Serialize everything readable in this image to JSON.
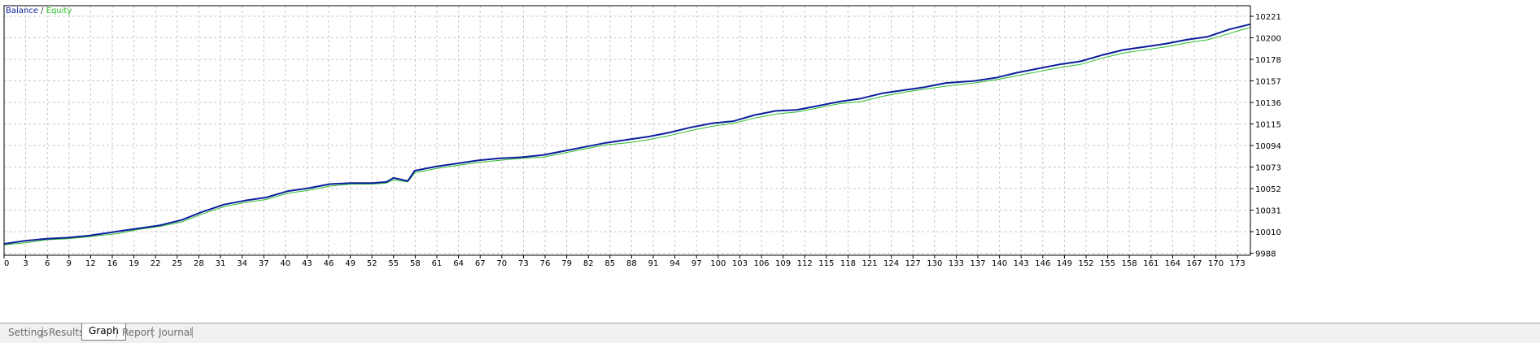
{
  "legend": {
    "balance": "Balance",
    "separator": "/",
    "equity": "Equity"
  },
  "tabs": [
    {
      "label": "Settings",
      "active": false
    },
    {
      "label": "Results",
      "active": false
    },
    {
      "label": "Graph",
      "active": true
    },
    {
      "label": "Report",
      "active": false
    },
    {
      "label": "Journal",
      "active": false
    }
  ],
  "colors": {
    "balance": "#0b1e9c",
    "equity": "#2dbd2d",
    "grid": "#c8c8c8",
    "frame": "#000000"
  },
  "chart_data": {
    "type": "line",
    "grid": true,
    "legend_position": "top-left",
    "x_tick_labels": [
      "0",
      "3",
      "6",
      "9",
      "12",
      "16",
      "19",
      "22",
      "25",
      "28",
      "31",
      "34",
      "37",
      "40",
      "43",
      "46",
      "49",
      "52",
      "55",
      "58",
      "61",
      "64",
      "67",
      "70",
      "73",
      "76",
      "79",
      "82",
      "85",
      "88",
      "91",
      "94",
      "97",
      "100",
      "103",
      "106",
      "109",
      "112",
      "115",
      "118",
      "121",
      "124",
      "127",
      "130",
      "133",
      "137",
      "140",
      "143",
      "146",
      "149",
      "152",
      "155",
      "158",
      "161",
      "164",
      "167",
      "170",
      "173"
    ],
    "y_tick_labels": [
      "10221",
      "10200",
      "10178",
      "10157",
      "10136",
      "10115",
      "10094",
      "10073",
      "10052",
      "10031",
      "10010",
      "9988"
    ],
    "xlim": [
      0,
      176
    ],
    "ylim": [
      9988,
      10230
    ],
    "series": [
      {
        "name": "Balance",
        "x": [
          0,
          3,
          6,
          9,
          12,
          16,
          19,
          22,
          25,
          28,
          31,
          34,
          37,
          40,
          43,
          46,
          49,
          52,
          54,
          55,
          57,
          58,
          61,
          64,
          67,
          70,
          73,
          76,
          79,
          82,
          85,
          88,
          91,
          94,
          97,
          100,
          103,
          106,
          109,
          112,
          115,
          118,
          121,
          124,
          127,
          130,
          133,
          137,
          140,
          143,
          146,
          149,
          152,
          155,
          158,
          161,
          164,
          167,
          170,
          173,
          176
        ],
        "y": [
          9999,
          10002,
          10004,
          10005,
          10007,
          10011,
          10014,
          10017,
          10022,
          10030,
          10037,
          10041,
          10044,
          10050,
          10053,
          10057,
          10058,
          10058,
          10059,
          10063,
          10060,
          10070,
          10074,
          10077,
          10080,
          10082,
          10083,
          10085,
          10089,
          10093,
          10097,
          10100,
          10103,
          10107,
          10112,
          10116,
          10118,
          10124,
          10128,
          10129,
          10133,
          10137,
          10140,
          10145,
          10148,
          10151,
          10155,
          10157,
          10160,
          10165,
          10169,
          10173,
          10176,
          10182,
          10187,
          10190,
          10193,
          10197,
          10200,
          10207,
          10212
        ]
      },
      {
        "name": "Equity",
        "x": [
          0,
          3,
          6,
          9,
          12,
          16,
          19,
          22,
          25,
          28,
          31,
          34,
          37,
          40,
          43,
          46,
          49,
          52,
          54,
          55,
          57,
          58,
          61,
          64,
          67,
          70,
          73,
          76,
          79,
          82,
          85,
          88,
          91,
          94,
          97,
          100,
          103,
          106,
          109,
          112,
          115,
          118,
          121,
          124,
          127,
          130,
          133,
          137,
          140,
          143,
          146,
          149,
          152,
          155,
          158,
          161,
          164,
          167,
          170,
          173,
          176
        ],
        "y": [
          9998,
          10000,
          10003,
          10004,
          10006,
          10009,
          10013,
          10016,
          10020,
          10028,
          10035,
          10039,
          10042,
          10048,
          10051,
          10055,
          10057,
          10057,
          10058,
          10061,
          10059,
          10068,
          10072,
          10075,
          10078,
          10080,
          10082,
          10083,
          10087,
          10091,
          10095,
          10097,
          10100,
          10104,
          10109,
          10113,
          10116,
          10121,
          10125,
          10127,
          10131,
          10135,
          10137,
          10142,
          10146,
          10149,
          10152,
          10155,
          10158,
          10162,
          10166,
          10170,
          10173,
          10179,
          10184,
          10187,
          10190,
          10194,
          10197,
          10203,
          10209
        ]
      }
    ]
  }
}
